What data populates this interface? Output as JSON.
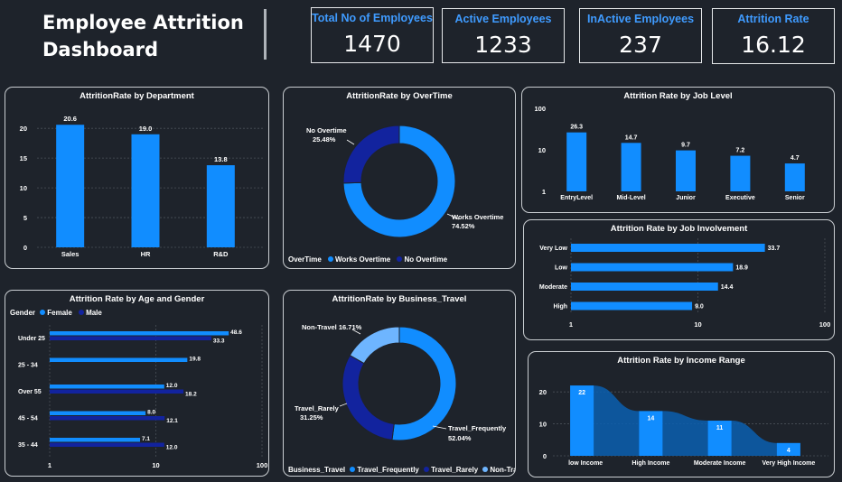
{
  "dashboard": {
    "title": "Employee Attrition Dashboard"
  },
  "kpis": [
    {
      "label": "Total No of Employees",
      "value": "1470"
    },
    {
      "label": "Active Employees",
      "value": "1233"
    },
    {
      "label": "InActive Employees",
      "value": "237"
    },
    {
      "label": "Attrition Rate",
      "value": "16.12"
    }
  ],
  "colors": {
    "primary": "#118dff",
    "secondary": "#12239e",
    "light": "#6eb5ff",
    "background": "#1e232b",
    "accent_text": "#3f9bff"
  },
  "chart_data": [
    {
      "id": "department",
      "type": "bar",
      "title": "AttritionRate by Department",
      "categories": [
        "Sales",
        "HR",
        "R&D"
      ],
      "values": [
        20.6,
        19.0,
        13.8
      ],
      "value_labels": [
        "20.6",
        "19.0",
        "13.8"
      ],
      "yticks": [
        0,
        5,
        10,
        15,
        20
      ],
      "ylim": [
        0,
        22
      ],
      "grid": true
    },
    {
      "id": "overtime",
      "type": "pie",
      "title": "AttritionRate by OverTime",
      "categories": [
        "Works Overtime",
        "No Overtime"
      ],
      "values": [
        74.52,
        25.48
      ],
      "slice_labels": [
        "Works Overtime",
        "No Overtime"
      ],
      "percent_labels": [
        "74.52%",
        "25.48%"
      ],
      "legend_title": "OverTime",
      "legend": [
        "Works Overtime",
        "No Overtime"
      ],
      "legend_position": "bottom-left"
    },
    {
      "id": "job_level",
      "type": "bar",
      "title": "Attrition Rate by Job Level",
      "categories": [
        "EntryLevel",
        "Mid-Level",
        "Junior",
        "Executive",
        "Senior"
      ],
      "values": [
        26.3,
        14.7,
        9.7,
        7.2,
        4.7
      ],
      "value_labels": [
        "26.3",
        "14.7",
        "9.7",
        "7.2",
        "4.7"
      ],
      "yscale": "log",
      "yticks": [
        "1",
        "10",
        "100"
      ],
      "ylim": [
        1,
        100
      ]
    },
    {
      "id": "job_involvement",
      "type": "bar",
      "orientation": "horizontal",
      "title": "Attrition Rate by Job Involvement",
      "categories": [
        "Very Low",
        "Low",
        "Moderate",
        "High"
      ],
      "values": [
        33.7,
        18.9,
        14.4,
        9.0
      ],
      "value_labels": [
        "33.7",
        "18.9",
        "14.4",
        "9.0"
      ],
      "xscale": "log",
      "xticks": [
        "1",
        "10",
        "100"
      ],
      "xlim": [
        1,
        100
      ]
    },
    {
      "id": "age_gender",
      "type": "bar",
      "orientation": "horizontal",
      "title": "Attrition Rate by Age and Gender",
      "categories": [
        "Under 25",
        "25 - 34",
        "Over 55",
        "45 - 54",
        "35 - 44"
      ],
      "series": [
        {
          "name": "Female",
          "values": [
            48.6,
            19.8,
            12.0,
            8.0,
            7.1
          ],
          "labels": [
            "48.6",
            "19.8",
            "12.0",
            "8.0",
            "7.1"
          ]
        },
        {
          "name": "Male",
          "values": [
            33.3,
            null,
            18.2,
            12.1,
            12.0
          ],
          "labels": [
            "33.3",
            "",
            "18.2",
            "12.1",
            "12.0"
          ]
        }
      ],
      "legend_title": "Gender",
      "legend": [
        "Female",
        "Male"
      ],
      "legend_position": "top-left",
      "xscale": "log",
      "xticks": [
        "1",
        "10",
        "100"
      ],
      "xlim": [
        1,
        100
      ]
    },
    {
      "id": "business_travel",
      "type": "pie",
      "title": "AttritionRate by Business_Travel",
      "categories": [
        "Travel_Frequently",
        "Travel_Rarely",
        "Non-Travel"
      ],
      "values": [
        52.04,
        31.25,
        16.71
      ],
      "slice_labels": [
        "Travel_Frequently",
        "Travel_Rarely",
        "Non-Travel"
      ],
      "percent_labels": [
        "52.04%",
        "31.25%",
        "16.71%"
      ],
      "legend_title": "Business_Travel",
      "legend": [
        "Travel_Frequently",
        "Travel_Rarely",
        "Non-Travel"
      ],
      "legend_position": "bottom-left"
    },
    {
      "id": "income_range",
      "type": "bar",
      "title": "Attrition Rate by Income Range",
      "categories": [
        "low Income",
        "High Income",
        "Moderate Income",
        "Very High Income"
      ],
      "values": [
        22,
        14,
        11,
        4
      ],
      "value_labels": [
        "22",
        "14",
        "11",
        "4"
      ],
      "yticks": [
        0,
        10,
        20
      ],
      "ylim": [
        0,
        24
      ],
      "ribbon": true
    }
  ]
}
